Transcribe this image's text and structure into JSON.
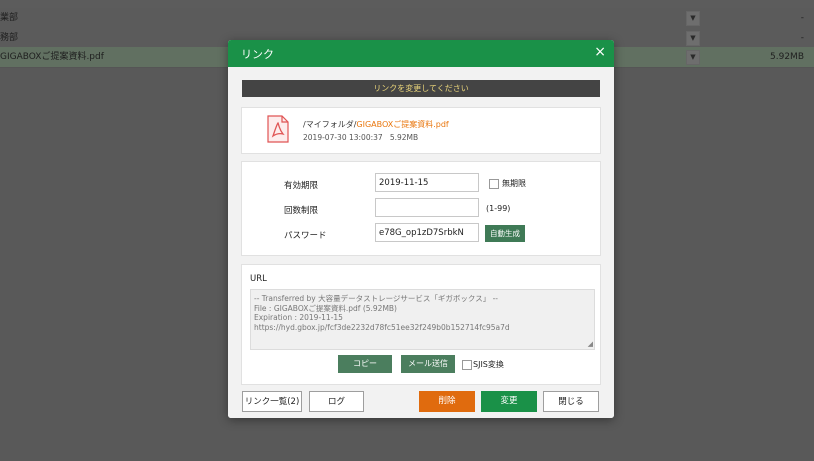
{
  "background": {
    "rows": [
      {
        "name": "業部",
        "size": "-"
      },
      {
        "name": "務部",
        "size": "-"
      },
      {
        "name": "GIGABOXご提案資料.pdf",
        "size": "5.92MB"
      }
    ]
  },
  "modal": {
    "title": "リンク",
    "close_icon": "×",
    "notice": "リンクを変更してください",
    "file": {
      "path_prefix": "/マイフォルダ/",
      "filename": "GIGABOXご提案資料.pdf",
      "date": "2019-07-30 13:00:37",
      "size": "5.92MB"
    },
    "form": {
      "expiry_label": "有効期限",
      "expiry_value": "2019-11-15",
      "unlimited_label": "無期限",
      "count_label": "回数制限",
      "count_value": "",
      "count_hint": "(1-99)",
      "password_label": "パスワード",
      "password_value": "e78G_op1zD7SrbkN",
      "autogen_label": "自動生成"
    },
    "url": {
      "label": "URL",
      "lines": [
        "-- Transferred by 大容量データストレージサービス「ギガボックス」 --",
        "File : GIGABOXご提案資料.pdf (5.92MB)",
        "Expiration : 2019-11-15",
        "https://hyd.gbox.jp/fcf3de2232d78fc51ee32f249b0b152714fc95a7d"
      ],
      "copy_label": "コピー",
      "mail_label": "メール送信",
      "sjis_label": "SJIS変換"
    },
    "footer": {
      "list_label": "リンク一覧(2)",
      "log_label": "ログ",
      "delete_label": "削除",
      "change_label": "変更",
      "close_label": "閉じる"
    }
  }
}
